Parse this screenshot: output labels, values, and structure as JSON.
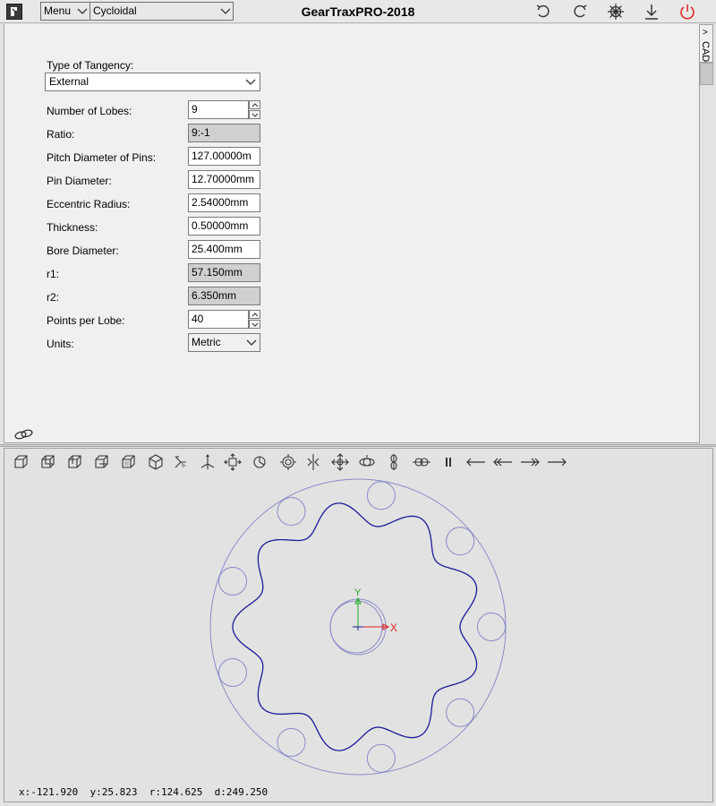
{
  "app": {
    "title": "GearTraxPRO-2018",
    "menu_label": "Menu",
    "profile_type": "Cycloidal"
  },
  "toolbar_icons": [
    "undo-icon",
    "redo-icon",
    "settings-icon",
    "download-icon",
    "power-icon"
  ],
  "side_tab": {
    "label": "CAD"
  },
  "tangency": {
    "label": "Type of Tangency:",
    "value": "External"
  },
  "fields": {
    "number_of_lobes": {
      "label": "Number of Lobes:",
      "value": "9"
    },
    "ratio": {
      "label": "Ratio:",
      "value": "9:-1"
    },
    "pitch_diameter_of_pins": {
      "label": "Pitch Diameter of Pins:",
      "value": "127.00000m"
    },
    "pin_diameter": {
      "label": "Pin Diameter:",
      "value": "12.70000mm"
    },
    "eccentric_radius": {
      "label": "Eccentric Radius:",
      "value": "2.54000mm"
    },
    "thickness": {
      "label": "Thickness:",
      "value": "0.50000mm"
    },
    "bore_diameter": {
      "label": "Bore Diameter:",
      "value": "25.400mm"
    },
    "r1": {
      "label": "r1:",
      "value": "57.150mm"
    },
    "r2": {
      "label": "r2:",
      "value": "6.350mm"
    },
    "points_per_lobe": {
      "label": "Points per Lobe:",
      "value": "40"
    },
    "units": {
      "label": "Units:",
      "value": "Metric"
    }
  },
  "view_toolbar_icons": [
    "view-front-icon",
    "view-back-icon",
    "view-left-icon",
    "view-right-icon",
    "view-top-icon",
    "view-iso-icon",
    "view-rotate-icon",
    "view-axes-icon",
    "pan-icon",
    "zoom-icon",
    "orbit-icon",
    "mirror-icon",
    "move-icon",
    "spin-icon",
    "flip-icon",
    "link-icon",
    "pause-icon",
    "step-back-icon",
    "rewind-icon",
    "fast-forward-icon",
    "step-forward-icon"
  ],
  "canvas": {
    "axis_x_label": "X",
    "axis_y_label": "Y",
    "colors": {
      "profile": "#1a1a99",
      "pins": "#8a8ac8",
      "x_axis": "#dd2222",
      "y_axis": "#22aa22"
    }
  },
  "status": {
    "x": "x:-121.920",
    "y": "y:25.823",
    "r": "r:124.625",
    "d": "d:249.250"
  }
}
